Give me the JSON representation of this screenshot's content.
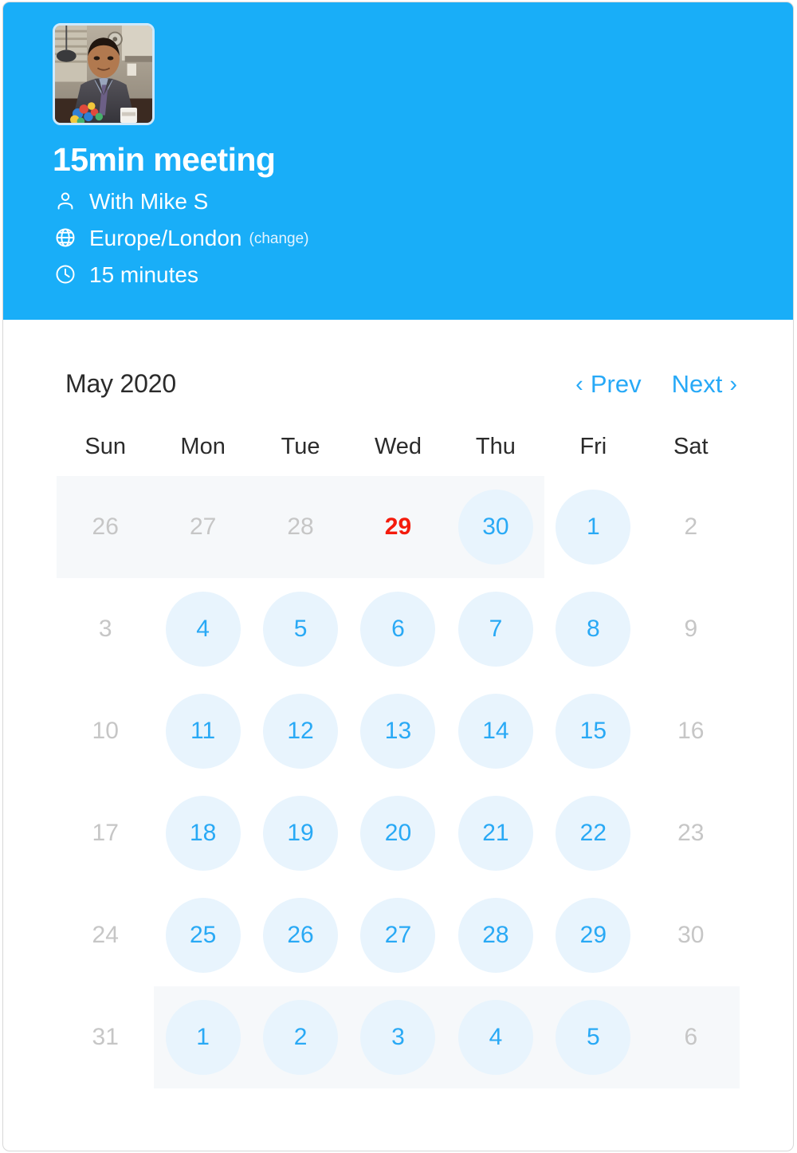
{
  "header": {
    "avatar_name": "avatar-photo",
    "title": "15min meeting",
    "host_icon": "person-icon",
    "host": "With Mike S",
    "timezone_icon": "globe-icon",
    "timezone": "Europe/London",
    "timezone_change_label": "(change)",
    "duration_icon": "clock-icon",
    "duration": "15 minutes",
    "background_color": "#19aef8"
  },
  "calendar": {
    "month_label": "May 2020",
    "prev_label": "Prev",
    "next_label": "Next",
    "prev_chevron": "‹",
    "next_chevron": "›",
    "nav_color": "#27a9f7",
    "weekdays": [
      "Sun",
      "Mon",
      "Tue",
      "Wed",
      "Thu",
      "Fri",
      "Sat"
    ],
    "available_color": "#29a9f5",
    "available_bg": "#e8f4fd",
    "muted_color": "#c6c6c6",
    "today_color": "#f41b0c",
    "band_color": "#f6f8fa",
    "weeks": [
      {
        "band": "first",
        "days": [
          {
            "label": "26",
            "state": "muted"
          },
          {
            "label": "27",
            "state": "muted"
          },
          {
            "label": "28",
            "state": "muted"
          },
          {
            "label": "29",
            "state": "today"
          },
          {
            "label": "30",
            "state": "available"
          },
          {
            "label": "1",
            "state": "available"
          },
          {
            "label": "2",
            "state": "muted"
          }
        ]
      },
      {
        "band": "none",
        "days": [
          {
            "label": "3",
            "state": "muted"
          },
          {
            "label": "4",
            "state": "available"
          },
          {
            "label": "5",
            "state": "available"
          },
          {
            "label": "6",
            "state": "available"
          },
          {
            "label": "7",
            "state": "available"
          },
          {
            "label": "8",
            "state": "available"
          },
          {
            "label": "9",
            "state": "muted"
          }
        ]
      },
      {
        "band": "none",
        "days": [
          {
            "label": "10",
            "state": "muted"
          },
          {
            "label": "11",
            "state": "available"
          },
          {
            "label": "12",
            "state": "available"
          },
          {
            "label": "13",
            "state": "available"
          },
          {
            "label": "14",
            "state": "available"
          },
          {
            "label": "15",
            "state": "available"
          },
          {
            "label": "16",
            "state": "muted"
          }
        ]
      },
      {
        "band": "none",
        "days": [
          {
            "label": "17",
            "state": "muted"
          },
          {
            "label": "18",
            "state": "available"
          },
          {
            "label": "19",
            "state": "available"
          },
          {
            "label": "20",
            "state": "available"
          },
          {
            "label": "21",
            "state": "available"
          },
          {
            "label": "22",
            "state": "available"
          },
          {
            "label": "23",
            "state": "muted"
          }
        ]
      },
      {
        "band": "none",
        "days": [
          {
            "label": "24",
            "state": "muted"
          },
          {
            "label": "25",
            "state": "available"
          },
          {
            "label": "26",
            "state": "available"
          },
          {
            "label": "27",
            "state": "available"
          },
          {
            "label": "28",
            "state": "available"
          },
          {
            "label": "29",
            "state": "available"
          },
          {
            "label": "30",
            "state": "muted"
          }
        ]
      },
      {
        "band": "last",
        "days": [
          {
            "label": "31",
            "state": "muted"
          },
          {
            "label": "1",
            "state": "available"
          },
          {
            "label": "2",
            "state": "available"
          },
          {
            "label": "3",
            "state": "available"
          },
          {
            "label": "4",
            "state": "available"
          },
          {
            "label": "5",
            "state": "available"
          },
          {
            "label": "6",
            "state": "muted"
          }
        ]
      }
    ]
  }
}
